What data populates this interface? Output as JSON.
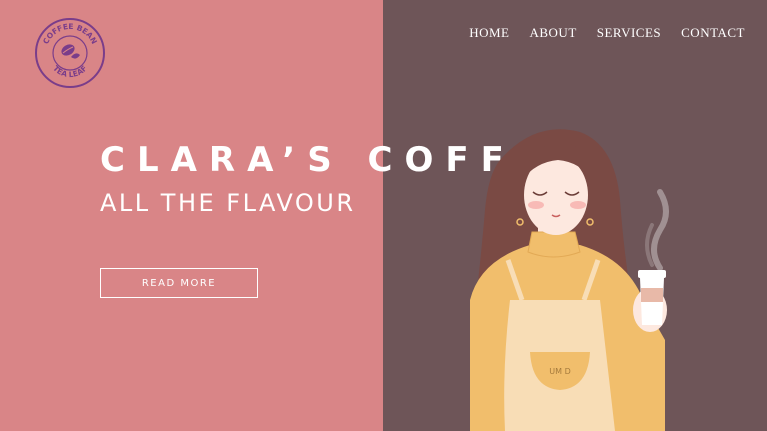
{
  "colors": {
    "left_bg": "#d98587",
    "right_bg": "#6e5558",
    "logo": "#7a3d8a",
    "text": "#ffffff",
    "sweater": "#f1be6c",
    "apron": "#f8ddb6",
    "hair": "#7a4a44",
    "skin": "#fde8df"
  },
  "logo": {
    "top_text": "COFFEE BEAN",
    "bottom_text": "TEA LEAF",
    "icon": "coffee-bean-leaf-icon"
  },
  "nav": {
    "items": [
      {
        "label": "HOME"
      },
      {
        "label": "ABOUT"
      },
      {
        "label": "SERVICES"
      },
      {
        "label": "CONTACT"
      }
    ]
  },
  "hero": {
    "title": "CLARA’S COFFEE",
    "subtitle": "ALL THE FLAVOUR",
    "button_label": "READ MORE"
  },
  "illustration": {
    "apron_text": "UM D"
  }
}
